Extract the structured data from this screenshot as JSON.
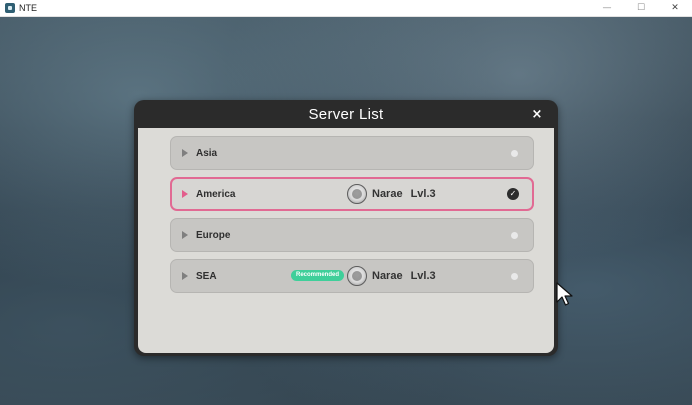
{
  "window": {
    "title": "NTE",
    "controls": {
      "minimize": "—",
      "maximize": "☐",
      "close": "✕"
    }
  },
  "dialog": {
    "title": "Server List",
    "close_glyph": "×"
  },
  "servers": [
    {
      "name": "Asia",
      "selected": false
    },
    {
      "name": "America",
      "selected": true,
      "character": "Narae",
      "level": "Lvl.3"
    },
    {
      "name": "Europe",
      "selected": false
    },
    {
      "name": "SEA",
      "selected": false,
      "badge": "Recommended",
      "character": "Narae",
      "level": "Lvl.3"
    }
  ],
  "icons": {
    "check": "✓"
  },
  "colors": {
    "accent": "#e16a93",
    "recommended": "#3fcf9a"
  }
}
